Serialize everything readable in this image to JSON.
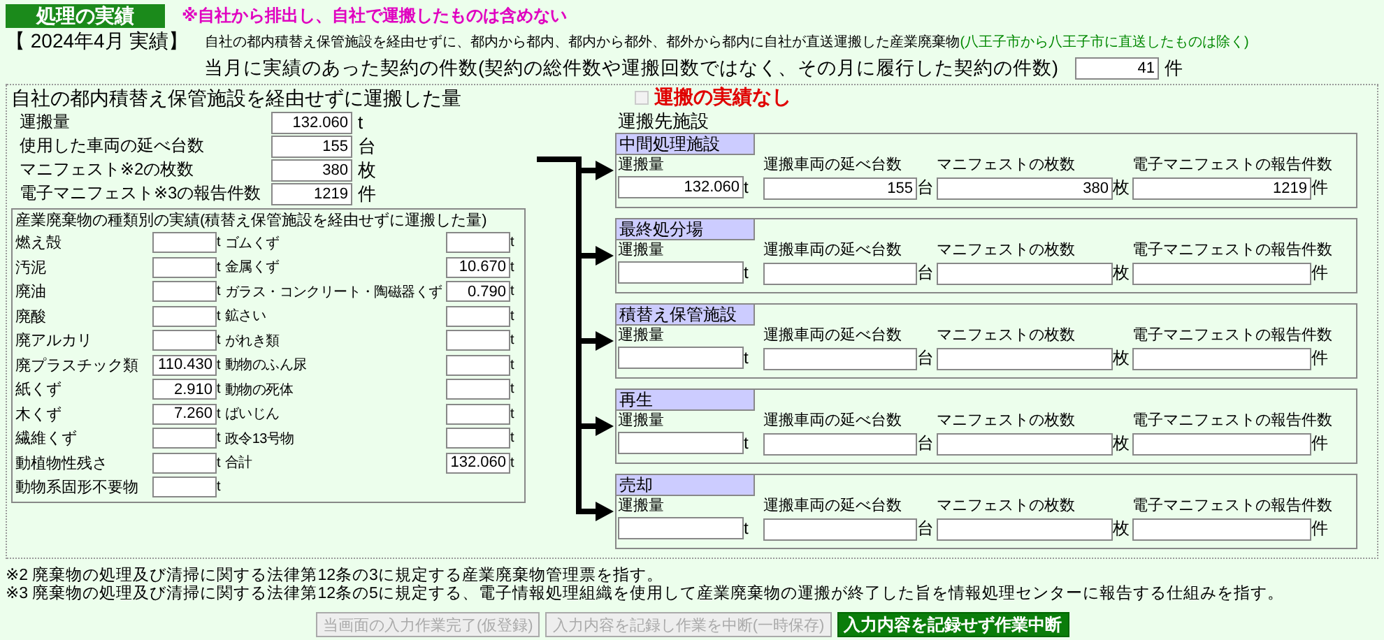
{
  "header": {
    "title": "処理の実績",
    "notice": "※自社から排出し、自社で運搬したものは含めない",
    "period": "【 2024年4月 実績】",
    "description": "自社の都内積替え保管施設を経由せずに、都内から都内、都内から都外、都外から都内に自社が直送運搬した産業廃棄物",
    "description_note": "(八王子市から八王子市に直送したものは除く)"
  },
  "contract_count": {
    "label": "当月に実績のあった契約の件数(契約の総件数や運搬回数ではなく、その月に履行した契約の件数)",
    "value": "41",
    "unit": "件"
  },
  "direct": {
    "title": "自社の都内積替え保管施設を経由せずに運搬した量",
    "rows": [
      {
        "label": "運搬量",
        "value": "132.060",
        "unit": "t"
      },
      {
        "label": "使用した車両の延べ台数",
        "value": "155",
        "unit": "台"
      },
      {
        "label": "マニフェスト※2の枚数",
        "value": "380",
        "unit": "枚"
      },
      {
        "label": "電子マニフェスト※3の報告件数",
        "value": "1219",
        "unit": "件"
      }
    ],
    "waste_types": {
      "title": "産業廃棄物の種類別の実績(積替え保管施設を経由せずに運搬した量)",
      "left_items": [
        {
          "label": "燃え殻",
          "unit": "t"
        },
        {
          "label": "汚泥",
          "unit": "t"
        },
        {
          "label": "廃油",
          "unit": "t"
        },
        {
          "label": "廃酸",
          "unit": "t"
        },
        {
          "label": "廃アルカリ",
          "unit": "t"
        },
        {
          "label": "廃プラスチック類",
          "value": "110.430",
          "unit": "t"
        },
        {
          "label": "紙くず",
          "value": "2.910",
          "unit": "t"
        },
        {
          "label": "木くず",
          "value": "7.260",
          "unit": "t"
        },
        {
          "label": "繊維くず",
          "unit": "t"
        },
        {
          "label": "動植物性残さ",
          "unit": "t"
        },
        {
          "label": "動物系固形不要物",
          "unit": "t"
        }
      ],
      "right_items": [
        {
          "label": "ゴムくず",
          "unit": "t"
        },
        {
          "label": "金属くず",
          "value": "10.670",
          "unit": "t"
        },
        {
          "label": "ガラス・コンクリート・陶磁器くず",
          "value": "0.790",
          "unit": "t"
        },
        {
          "label": "鉱さい",
          "unit": "t"
        },
        {
          "label": "がれき類",
          "unit": "t"
        },
        {
          "label": "動物のふん尿",
          "unit": "t"
        },
        {
          "label": "動物の死体",
          "unit": "t"
        },
        {
          "label": "ばいじん",
          "unit": "t"
        },
        {
          "label": "政令13号物",
          "unit": "t"
        },
        {
          "label": "合計",
          "value": "132.060",
          "unit": "t"
        }
      ]
    }
  },
  "no_transport": {
    "label": "運搬の実績なし",
    "checked": false,
    "disabled": true
  },
  "destinations": {
    "title": "運搬先施設",
    "facilities": [
      {
        "name": "中間処理施設",
        "fields": [
          {
            "label": "運搬量",
            "value": "132.060",
            "unit": "t"
          },
          {
            "label": "運搬車両の延べ台数",
            "value": "155",
            "unit": "台"
          },
          {
            "label": "マニフェストの枚数",
            "value": "380",
            "unit": "枚"
          },
          {
            "label": "電子マニフェストの報告件数",
            "value": "1219",
            "unit": "件"
          }
        ]
      },
      {
        "name": "最終処分場",
        "fields": [
          {
            "label": "運搬量",
            "unit": "t"
          },
          {
            "label": "運搬車両の延べ台数",
            "unit": "台"
          },
          {
            "label": "マニフェストの枚数",
            "unit": "枚"
          },
          {
            "label": "電子マニフェストの報告件数",
            "unit": "件"
          }
        ]
      },
      {
        "name": "積替え保管施設",
        "fields": [
          {
            "label": "運搬量",
            "unit": "t"
          },
          {
            "label": "運搬車両の延べ台数",
            "unit": "台"
          },
          {
            "label": "マニフェストの枚数",
            "unit": "枚"
          },
          {
            "label": "電子マニフェストの報告件数",
            "unit": "件"
          }
        ]
      },
      {
        "name": "再生",
        "fields": [
          {
            "label": "運搬量",
            "unit": "t"
          },
          {
            "label": "運搬車両の延べ台数",
            "unit": "台"
          },
          {
            "label": "マニフェストの枚数",
            "unit": "枚"
          },
          {
            "label": "電子マニフェストの報告件数",
            "unit": "件"
          }
        ]
      },
      {
        "name": "売却",
        "fields": [
          {
            "label": "運搬量",
            "unit": "t"
          },
          {
            "label": "運搬車両の延べ台数",
            "unit": "台"
          },
          {
            "label": "マニフェストの枚数",
            "unit": "枚"
          },
          {
            "label": "電子マニフェストの報告件数",
            "unit": "件"
          }
        ]
      }
    ]
  },
  "footnotes": [
    "※2 廃棄物の処理及び清掃に関する法律第12条の3に規定する産業廃棄物管理票を指す。",
    "※3 廃棄物の処理及び清掃に関する法律第12条の5に規定する、電子情報処理組織を使用して産業廃棄物の運搬が終了した旨を情報処理センターに報告する仕組みを指す。"
  ],
  "buttons": [
    {
      "label": "当画面の入力作業完了(仮登録)",
      "disabled": true
    },
    {
      "label": "入力内容を記録し作業を中断(一時保存)",
      "disabled": true
    },
    {
      "label": "入力内容を記録せず作業中断",
      "disabled": false
    }
  ]
}
